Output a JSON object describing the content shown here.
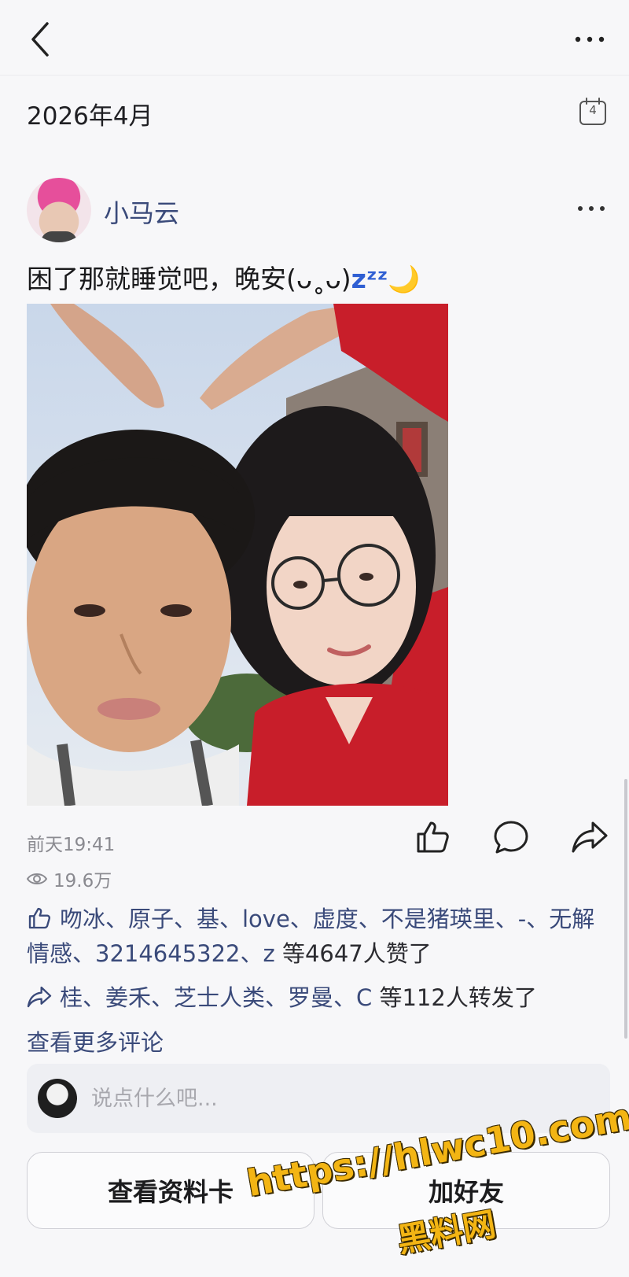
{
  "header": {
    "back_icon": "chevron-left-icon",
    "more_icon": "more-horizontal-icon"
  },
  "month": {
    "label": "2026年4月",
    "calendar_icon": "calendar-icon",
    "calendar_day": "4"
  },
  "post": {
    "username": "小马云",
    "text": "困了那就睡觉吧，晚安(ᴗ˳ᴗ)",
    "text_zzz": "zᶻᶻ",
    "text_emoji": "🌙",
    "timestamp": "前天19:41",
    "views": "19.6万",
    "actions": {
      "like_icon": "thumbs-up-icon",
      "comment_icon": "comment-bubble-icon",
      "share_icon": "share-arrow-icon"
    },
    "likes_names": "吻冰、原子、基、love、虚度、不是猪瑛里、-、无解情感、3214645322、z",
    "likes_suffix": " 等4647人赞了",
    "shares_names": "桂、姜禾、芝士人类、罗曼、C",
    "shares_suffix": " 等112人转发了",
    "more_comments": "查看更多评论"
  },
  "comment": {
    "placeholder": "说点什么吧..."
  },
  "buttons": {
    "profile_card": "查看资料卡",
    "add_friend": "加好友"
  },
  "watermark": {
    "line1": "https://hlwc10.com",
    "line2": "黑料网"
  },
  "colors": {
    "link_blue": "#3a4a7a",
    "watermark_gold": "#f3b514",
    "background": "#f7f7f9"
  }
}
